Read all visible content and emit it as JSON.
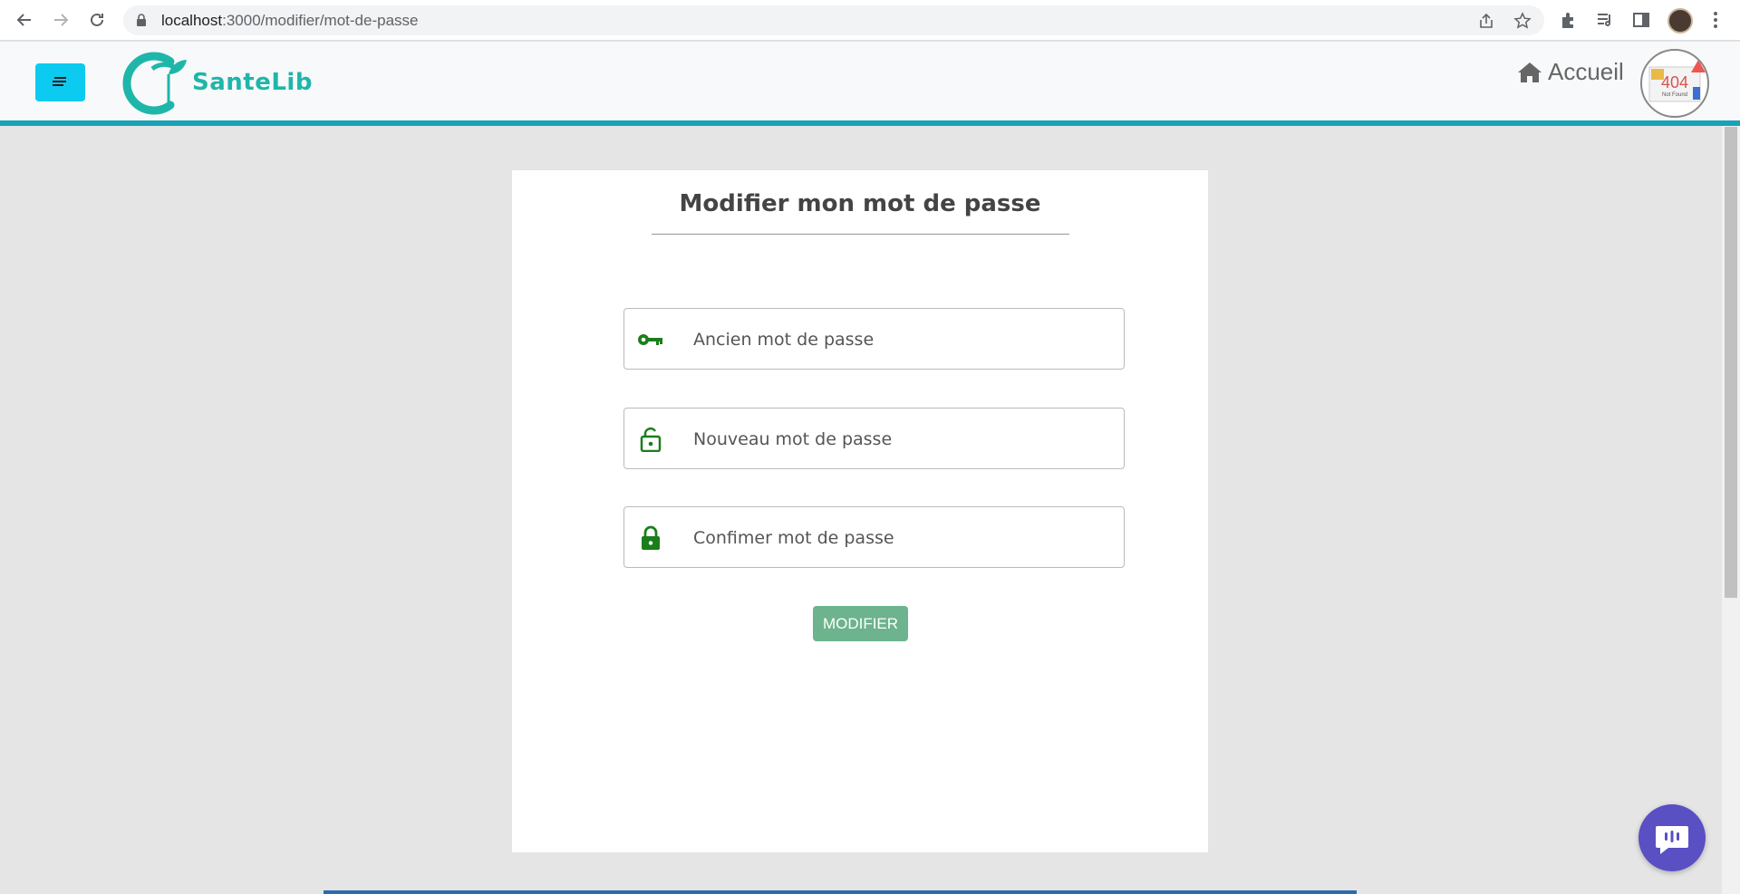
{
  "browser": {
    "url_host": "localhost",
    "url_path": ":3000/modifier/mot-de-passe"
  },
  "header": {
    "brand": "SanteLib",
    "home_label": "Accueil",
    "avatar_text": "404",
    "avatar_subtext": "Not Found"
  },
  "form": {
    "title": "Modifier mon mot de passe",
    "old_password_placeholder": "Ancien mot de passe",
    "new_password_placeholder": "Nouveau mot de passe",
    "confirm_password_placeholder": "Confimer mot de passe",
    "submit_label": "MODIFIER"
  },
  "colors": {
    "accent": "#17a2b8",
    "menu_button": "#0dcaf0",
    "icon_green": "#1a7f1a",
    "submit": "#6db38d",
    "chat": "#5b4fc4",
    "brand": "#1fb6aa"
  }
}
